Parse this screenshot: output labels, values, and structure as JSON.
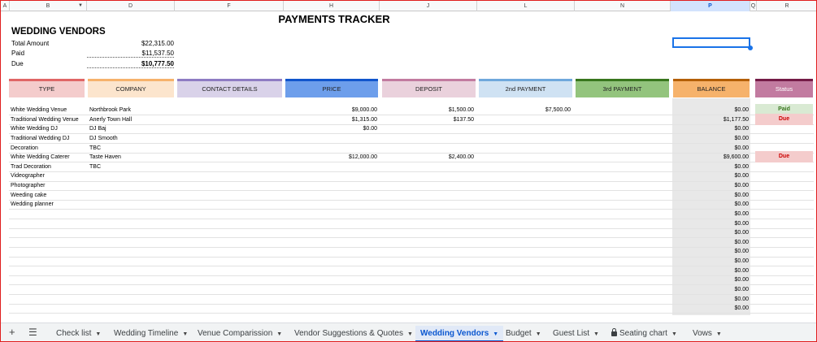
{
  "columns": [
    "A",
    "B",
    "D",
    "F",
    "H",
    "J",
    "L",
    "N",
    "P",
    "Q",
    "R"
  ],
  "selected_column": "P",
  "title": "PAYMENTS TRACKER",
  "summary": {
    "title": "WEDDING VENDORS",
    "rows": [
      {
        "label": "Total Amount",
        "value": "$22,315.00"
      },
      {
        "label": "Paid",
        "value": "$11,537.50"
      },
      {
        "label": "Due",
        "value": "$10,777.50"
      }
    ]
  },
  "headers": [
    "TYPE",
    "COMPANY",
    "CONTACT DETAILS",
    "PRICE",
    "DEPOSIT",
    "2nd PAYMENT",
    "3rd PAYMENT",
    "BALANCE",
    "Status"
  ],
  "header_colors": {
    "type": "#f4cccc",
    "company": "#fce5cd",
    "contact": "#d9d2e9",
    "price": "#6d9eeb",
    "deposit": "#ead1dc",
    "second": "#cfe2f3",
    "third": "#93c47d",
    "balance": "#f6b26b",
    "status": "#c27ba0"
  },
  "rows": [
    {
      "type": "White Wedding Venue",
      "company": "Northbrook Park",
      "contact": "",
      "price": "$9,000.00",
      "deposit": "$1,500.00",
      "second": "$7,500.00",
      "third": "",
      "balance": "$0.00",
      "status": "Paid"
    },
    {
      "type": "Traditional Wedding Venue",
      "company": "Anerly Town Hall",
      "contact": "",
      "price": "$1,315.00",
      "deposit": "$137.50",
      "second": "",
      "third": "",
      "balance": "$1,177.50",
      "status": "Due"
    },
    {
      "type": "White Wedding DJ",
      "company": "DJ Baj",
      "contact": "",
      "price": "$0.00",
      "deposit": "",
      "second": "",
      "third": "",
      "balance": "$0.00",
      "status": ""
    },
    {
      "type": "Traditional Wedding DJ",
      "company": "DJ Smooth",
      "contact": "",
      "price": "",
      "deposit": "",
      "second": "",
      "third": "",
      "balance": "$0.00",
      "status": ""
    },
    {
      "type": "Decoration",
      "company": "TBC",
      "contact": "",
      "price": "",
      "deposit": "",
      "second": "",
      "third": "",
      "balance": "$0.00",
      "status": ""
    },
    {
      "type": "White Wedding Caterer",
      "company": "Taste Haven",
      "contact": "",
      "price": "$12,000.00",
      "deposit": "$2,400.00",
      "second": "",
      "third": "",
      "balance": "$9,600.00",
      "status": "Due"
    },
    {
      "type": "Trad Decoration",
      "company": "TBC",
      "contact": "",
      "price": "",
      "deposit": "",
      "second": "",
      "third": "",
      "balance": "$0.00",
      "status": ""
    },
    {
      "type": "Videographer",
      "company": "",
      "contact": "",
      "price": "",
      "deposit": "",
      "second": "",
      "third": "",
      "balance": "$0.00",
      "status": ""
    },
    {
      "type": "Photographer",
      "company": "",
      "contact": "",
      "price": "",
      "deposit": "",
      "second": "",
      "third": "",
      "balance": "$0.00",
      "status": ""
    },
    {
      "type": "Weeding cake",
      "company": "",
      "contact": "",
      "price": "",
      "deposit": "",
      "second": "",
      "third": "",
      "balance": "$0.00",
      "status": ""
    },
    {
      "type": "Wedding planner",
      "company": "",
      "contact": "",
      "price": "",
      "deposit": "",
      "second": "",
      "third": "",
      "balance": "$0.00",
      "status": ""
    },
    {
      "type": "",
      "company": "",
      "contact": "",
      "price": "",
      "deposit": "",
      "second": "",
      "third": "",
      "balance": "$0.00",
      "status": ""
    },
    {
      "type": "",
      "company": "",
      "contact": "",
      "price": "",
      "deposit": "",
      "second": "",
      "third": "",
      "balance": "$0.00",
      "status": ""
    },
    {
      "type": "",
      "company": "",
      "contact": "",
      "price": "",
      "deposit": "",
      "second": "",
      "third": "",
      "balance": "$0.00",
      "status": ""
    },
    {
      "type": "",
      "company": "",
      "contact": "",
      "price": "",
      "deposit": "",
      "second": "",
      "third": "",
      "balance": "$0.00",
      "status": ""
    },
    {
      "type": "",
      "company": "",
      "contact": "",
      "price": "",
      "deposit": "",
      "second": "",
      "third": "",
      "balance": "$0.00",
      "status": ""
    },
    {
      "type": "",
      "company": "",
      "contact": "",
      "price": "",
      "deposit": "",
      "second": "",
      "third": "",
      "balance": "$0.00",
      "status": ""
    },
    {
      "type": "",
      "company": "",
      "contact": "",
      "price": "",
      "deposit": "",
      "second": "",
      "third": "",
      "balance": "$0.00",
      "status": ""
    },
    {
      "type": "",
      "company": "",
      "contact": "",
      "price": "",
      "deposit": "",
      "second": "",
      "third": "",
      "balance": "$0.00",
      "status": ""
    },
    {
      "type": "",
      "company": "",
      "contact": "",
      "price": "",
      "deposit": "",
      "second": "",
      "third": "",
      "balance": "$0.00",
      "status": ""
    },
    {
      "type": "",
      "company": "",
      "contact": "",
      "price": "",
      "deposit": "",
      "second": "",
      "third": "",
      "balance": "$0.00",
      "status": ""
    },
    {
      "type": "",
      "company": "",
      "contact": "",
      "price": "",
      "deposit": "",
      "second": "",
      "third": "",
      "balance": "$0.00",
      "status": ""
    },
    {
      "type": "",
      "company": "",
      "contact": "",
      "price": "",
      "deposit": "",
      "second": "",
      "third": "",
      "balance": "$0.00",
      "status": ""
    }
  ],
  "toolbar": {
    "add_icon": "plus-icon",
    "menu_icon": "hamburger-menu-icon"
  },
  "tabs": [
    {
      "label": "Check list",
      "active": false,
      "locked": false
    },
    {
      "label": "Wedding Timeline",
      "active": false,
      "locked": false
    },
    {
      "label": "Venue Comparission",
      "active": false,
      "locked": false
    },
    {
      "label": "Vendor Suggestions & Quotes",
      "active": false,
      "locked": false
    },
    {
      "label": "Wedding Vendors",
      "active": true,
      "locked": false
    },
    {
      "label": "Budget",
      "active": false,
      "locked": false
    },
    {
      "label": "Guest List",
      "active": false,
      "locked": false
    },
    {
      "label": "Seating chart",
      "active": false,
      "locked": true
    },
    {
      "label": "Vows",
      "active": false,
      "locked": false
    }
  ]
}
